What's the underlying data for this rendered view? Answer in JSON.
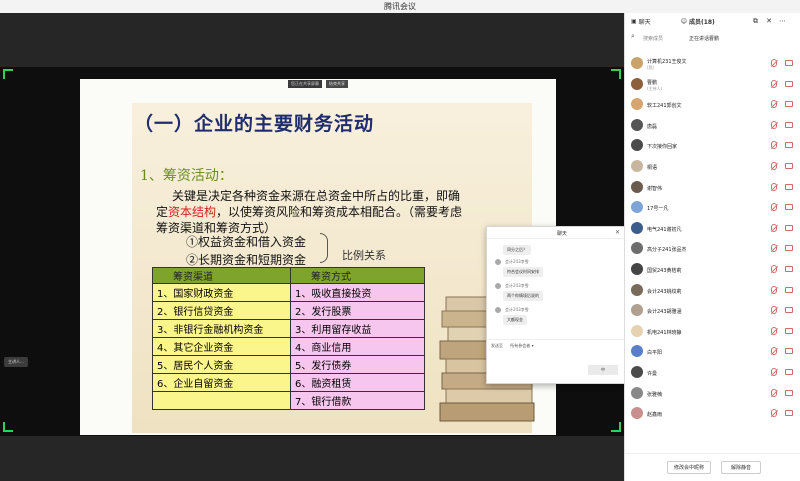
{
  "window": {
    "title": "腾讯会议"
  },
  "slide": {
    "header_chips": [
      "您正在共享屏幕",
      "结束共享"
    ],
    "title": "（一）企业的主要财务活动",
    "subtitle": "1、筹资活动：",
    "paragraph": {
      "line1": "关键是决定各种资金来源在总资金中所占的比重，即确",
      "line2_prefix": "定",
      "line2_highlight": "资本结构",
      "line2_suffix": "，以使筹资风险和筹资成本相配合。（需要考虑",
      "line3": "筹资渠道和筹资方式）"
    },
    "items": [
      "①权益资金和借入资金",
      "②长期资金和短期资金"
    ],
    "ratio_label": "比例关系",
    "table": {
      "headers": [
        "筹资渠道",
        "筹资方式"
      ],
      "rows": [
        [
          "1、国家财政资金",
          "1、吸收直接投资"
        ],
        [
          "2、银行信贷资金",
          "2、发行股票"
        ],
        [
          "3、非银行金融机构资金",
          "3、利用留存收益"
        ],
        [
          "4、其它企业资金",
          "4、商业信用"
        ],
        [
          "5、居民个人资金",
          "5、发行债券"
        ],
        [
          "6、企业自留资金",
          "6、融资租赁"
        ],
        [
          "",
          "7、银行借款"
        ]
      ]
    }
  },
  "chat_popup": {
    "title": "聊天",
    "messages": [
      {
        "sender": "",
        "text": "同分之后？"
      },
      {
        "sender": "会计243李雪",
        "text": "符合会议时间安排"
      },
      {
        "sender": "会计243李雪",
        "text": "两个你情境后说的"
      },
      {
        "sender": "会计243李雪",
        "text": "大额现金"
      }
    ],
    "input_label": "发送至",
    "input_target": "所有参会者",
    "send_label": "中"
  },
  "viewer_chip": "主讲人...",
  "panel": {
    "tabs": [
      "聊天",
      "成员(18)"
    ],
    "search_placeholder": "搜索成员",
    "speaking_label": "正在讲话:",
    "speaking_name": "曹鹏",
    "members": [
      {
        "name": "计算机231王俊文",
        "role": "(我)",
        "color": "#c9a36b"
      },
      {
        "name": "曹鹏",
        "role": "(主持人)",
        "color": "#8b5e3c"
      },
      {
        "name": "软工241郭创文",
        "role": "",
        "color": "#d7a56f"
      },
      {
        "name": "唐磊",
        "role": "",
        "color": "#555"
      },
      {
        "name": "下次接你回家",
        "role": "",
        "color": "#4a4a4a"
      },
      {
        "name": "桐语",
        "role": "",
        "color": "#c7b79e"
      },
      {
        "name": "谢智伟",
        "role": "",
        "color": "#6b5b4f"
      },
      {
        "name": "17号一凡",
        "role": "",
        "color": "#7fa4d8"
      },
      {
        "name": "电气241谢初凡",
        "role": "",
        "color": "#3c5d8c"
      },
      {
        "name": "高分子241张品杰",
        "role": "",
        "color": "#6d6d6d"
      },
      {
        "name": "国贸243黄桔莉",
        "role": "",
        "color": "#444"
      },
      {
        "name": "会计243姚纹莉",
        "role": "",
        "color": "#7a6a5a"
      },
      {
        "name": "会计243胡雅涵",
        "role": "",
        "color": "#b0a090"
      },
      {
        "name": "机电241林晓静",
        "role": "",
        "color": "#e6d2b0"
      },
      {
        "name": "白平阳",
        "role": "",
        "color": "#5b7fc7"
      },
      {
        "name": "许曼",
        "role": "",
        "color": "#4b4b4b"
      },
      {
        "name": "张雅楠",
        "role": "",
        "color": "#888"
      },
      {
        "name": "赵鑫雨",
        "role": "",
        "color": "#c98f8f"
      }
    ],
    "buttons": [
      "修改会中昵称",
      "解除静音"
    ]
  },
  "colors": {
    "accent_green": "#2fd15a",
    "mute_red": "#d36b6b"
  }
}
